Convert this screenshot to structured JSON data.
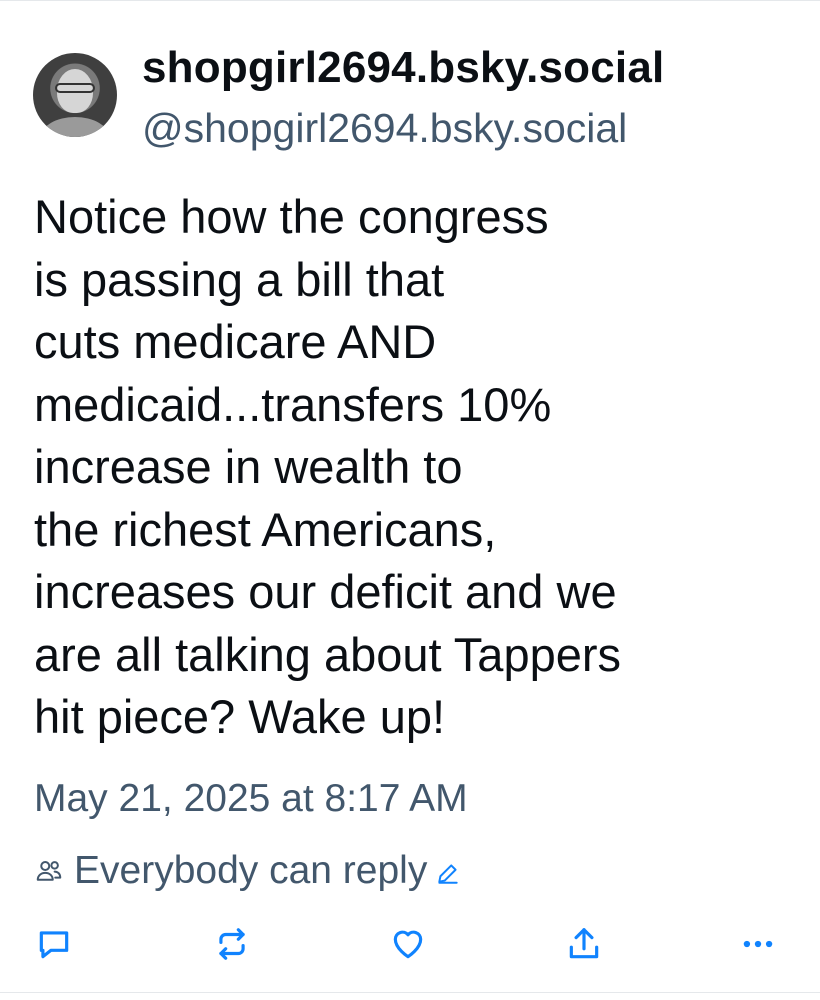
{
  "post": {
    "display_name": "shopgirl2694.bsky.social",
    "handle": "@shopgirl2694.bsky.social",
    "text_lines": [
      "Notice how the congress",
      "is passing a bill that",
      "cuts medicare AND",
      "medicaid...transfers 10%",
      "increase in wealth to",
      "the richest Americans,",
      "increases our deficit and we",
      "are all talking about Tappers",
      "hit piece? Wake up!"
    ],
    "timestamp": "May 21, 2025 at 8:17 AM",
    "reply_setting": "Everybody can reply"
  },
  "icons": {
    "reply": "speech-bubble-icon",
    "repost": "repost-arrows-icon",
    "like": "heart-icon",
    "share": "share-upload-icon",
    "more": "more-dots-icon",
    "reply_setting": "people-icon",
    "edit": "pencil-icon"
  },
  "colors": {
    "text": "#0b0f14",
    "muted": "#42576c",
    "icon": "#1083fe"
  }
}
